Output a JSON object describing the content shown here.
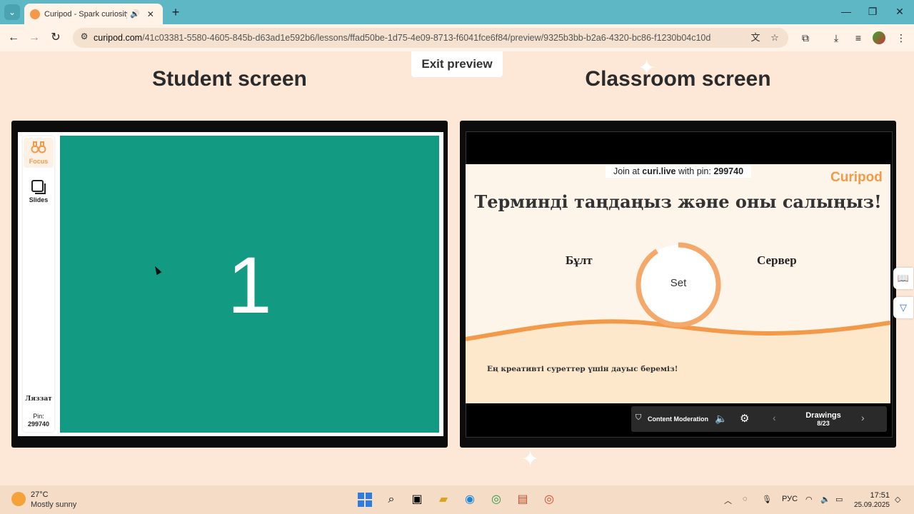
{
  "browser": {
    "tab_title": "Curipod - Spark curiosity w",
    "url_host": "curipod.com",
    "url_path": "/41c03381-5580-4605-845b-d63ad1e592b6/lessons/ffad50be-1d75-4e09-8713-f6041fce6f84/preview/9325b3bb-b2a6-4320-bc86-f1230b04c10d"
  },
  "page": {
    "exit_preview": "Exit preview",
    "student_heading": "Student screen",
    "classroom_heading": "Classroom screen"
  },
  "student": {
    "sidebar": [
      {
        "label": "Focus",
        "icon": "binoculars-icon"
      },
      {
        "label": "Slides",
        "icon": "slides-icon"
      }
    ],
    "big_number": "1",
    "user_name": "Ляззат",
    "pin_label": "Pin:",
    "pin_value": "299740"
  },
  "classroom": {
    "join_prefix": "Join at ",
    "join_site": "curi.live",
    "join_mid": " with pin: ",
    "join_pin": "299740",
    "logo": "Curipod",
    "title": "Терминді таңдаңыз және оны салыңыз!",
    "word_left": "Бұлт",
    "word_right": "Сервер",
    "set_label": "Set",
    "footer": "Ең креативті суреттер үшін дауыс береміз!",
    "controls": {
      "moderation": "Content Moderation",
      "section": "Drawings",
      "counter": "8/23"
    },
    "accent_color": "#f29a4a"
  },
  "taskbar": {
    "temperature": "27°C",
    "weather": "Mostly sunny",
    "language": "РУС",
    "time": "17:51",
    "date": "25.09.2025"
  }
}
